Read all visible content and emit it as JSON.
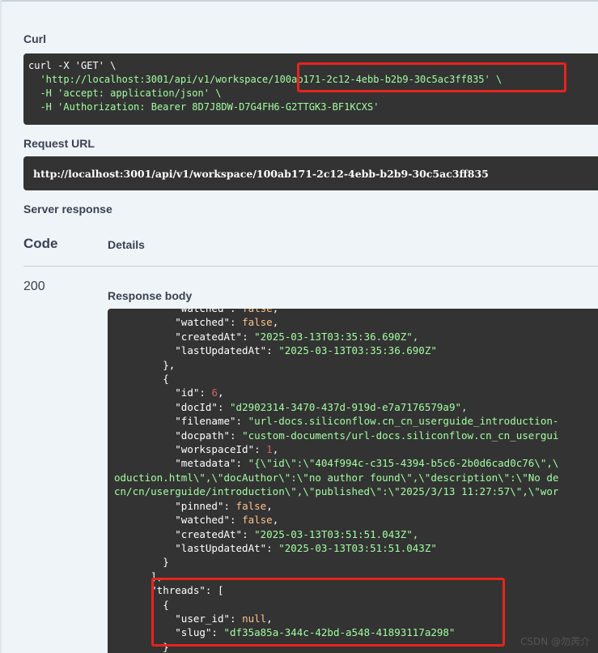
{
  "curl": {
    "label": "Curl",
    "lines": [
      "curl -X 'GET' \\",
      "  'http://localhost:3001/api/v1/workspace/100ab171-2c12-4ebb-b2b9-30c5ac3ff835' \\",
      "  -H 'accept: application/json' \\",
      "  -H 'Authorization: Bearer 8D7J8DW-D7G4FH6-G2TTGK3-BF1KCXS'"
    ]
  },
  "request_url": {
    "label": "Request URL",
    "value": "http://localhost:3001/api/v1/workspace/100ab171-2c12-4ebb-b2b9-30c5ac3ff835"
  },
  "server_response": {
    "label": "Server response",
    "col_code": "Code",
    "col_details": "Details",
    "status_code": "200",
    "response_body_label": "Response body"
  },
  "response_body_lines": [
    "          \"watched\": false,",
    "          \"watched\": false,",
    "          \"createdAt\": \"2025-03-13T03:35:36.690Z\",",
    "          \"lastUpdatedAt\": \"2025-03-13T03:35:36.690Z\"",
    "        },",
    "        {",
    "          \"id\": 6,",
    "          \"docId\": \"d2902314-3470-437d-919d-e7a7176579a9\",",
    "          \"filename\": \"url-docs.siliconflow.cn_cn_userguide_introduction-",
    "          \"docpath\": \"custom-documents/url-docs.siliconflow.cn_cn_usergui",
    "          \"workspaceId\": 1,",
    "          \"metadata\": \"{\\\"id\\\":\\\"404f994c-c315-4394-b5c6-2b0d6cad0c76\\\",\\",
    "oduction.html\\\",\\\"docAuthor\\\":\\\"no author found\\\",\\\"description\\\":\\\"No de",
    "cn/cn/userguide/introduction\\\",\\\"published\\\":\\\"2025/3/13 11:27:57\\\",\\\"wor",
    "          \"pinned\": false,",
    "          \"watched\": false,",
    "          \"createdAt\": \"2025-03-13T03:51:51.043Z\",",
    "          \"lastUpdatedAt\": \"2025-03-13T03:51:51.043Z\"",
    "        }",
    "      ],",
    "      \"threads\": [",
    "        {",
    "          \"user_id\": null,",
    "          \"slug\": \"df35a85a-344c-42bd-a548-41893117a298\"",
    "        }"
  ],
  "watermark": "CSDN @勿芮介",
  "colors": {
    "code_bg": "#333333",
    "string": "#a2fca2",
    "number": "#d36363",
    "highlight": "#e8231d"
  }
}
